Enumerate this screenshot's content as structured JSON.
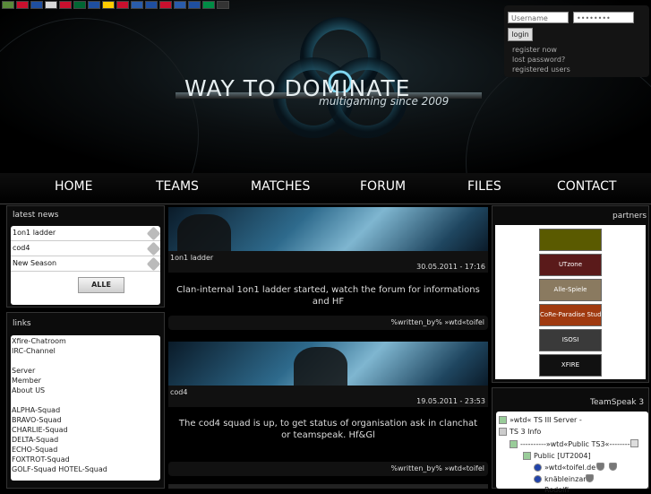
{
  "header": {
    "flags": [
      "#5a8a3a",
      "#c8102e",
      "#1f4fa0",
      "#d8d8d8",
      "#c8102e",
      "#006633",
      "#1f4fa0",
      "#ffcc00",
      "#c8102e",
      "#2a5caa",
      "#1f4fa0",
      "#c8102e",
      "#2a5caa",
      "#1f4fa0",
      "#008c45",
      "#333333"
    ],
    "title": "WAY TO DOMINATE",
    "subtitle": "multigaming since 2009"
  },
  "login": {
    "username_placeholder": "Username",
    "password_value": "••••••••",
    "button": "login",
    "links": [
      "register now",
      "lost password?",
      "registered users"
    ]
  },
  "nav": [
    "HOME",
    "TEAMS",
    "MATCHES",
    "FORUM",
    "FILES",
    "CONTACT"
  ],
  "latest_news": {
    "title": "latest news",
    "items": [
      "1on1 ladder",
      "cod4",
      "New Season"
    ],
    "all_button": "ALLE"
  },
  "links": {
    "title": "links",
    "lines": [
      "Xfire-Chatroom",
      "IRC-Channel",
      "",
      "Server",
      "Member",
      "About US",
      "",
      "ALPHA-Squad",
      "BRAVO-Squad",
      "CHARLIE-Squad",
      "DELTA-Squad",
      "ECHO-Squad",
      "FOXTROT-Squad",
      "GOLF-Squad HOTEL-Squad"
    ]
  },
  "articles": [
    {
      "label": "1on1 ladder",
      "date": "30.05.2011 - 17:16",
      "body": "Clan-internal 1on1 ladder started, watch the forum for informations and HF",
      "footer": "%written_by% »wtd«toifel"
    },
    {
      "label": "cod4",
      "date": "19.05.2011 - 23:53",
      "body": "The cod4 squad is up, to get status of organisation ask in clanchat or teamspeak. Hf&Gl",
      "footer": "%written_by% »wtd«toifel"
    }
  ],
  "partners": {
    "title": "partners",
    "items": [
      {
        "label": "",
        "color": "#6a6a00"
      },
      {
        "label": "UTzone",
        "color": "#5a1a1a"
      },
      {
        "label": "Alle-Spiele",
        "color": "#8a7a60"
      },
      {
        "label": "CoRe-Paradise Studios",
        "color": "#a03a10"
      },
      {
        "label": "ISOSI",
        "color": "#3a3a3a"
      },
      {
        "label": "XFIRE",
        "color": "#111111"
      }
    ]
  },
  "teamspeak": {
    "title": "TeamSpeak 3",
    "lines": [
      "»wtd« TS III Server -",
      "TS 3 Info",
      "----------»wtd«Public TS3«----------",
      "Public [UT2004]",
      "»wtd«toifel.de",
      "knäbleinzarl",
      "Rodolfi"
    ]
  }
}
